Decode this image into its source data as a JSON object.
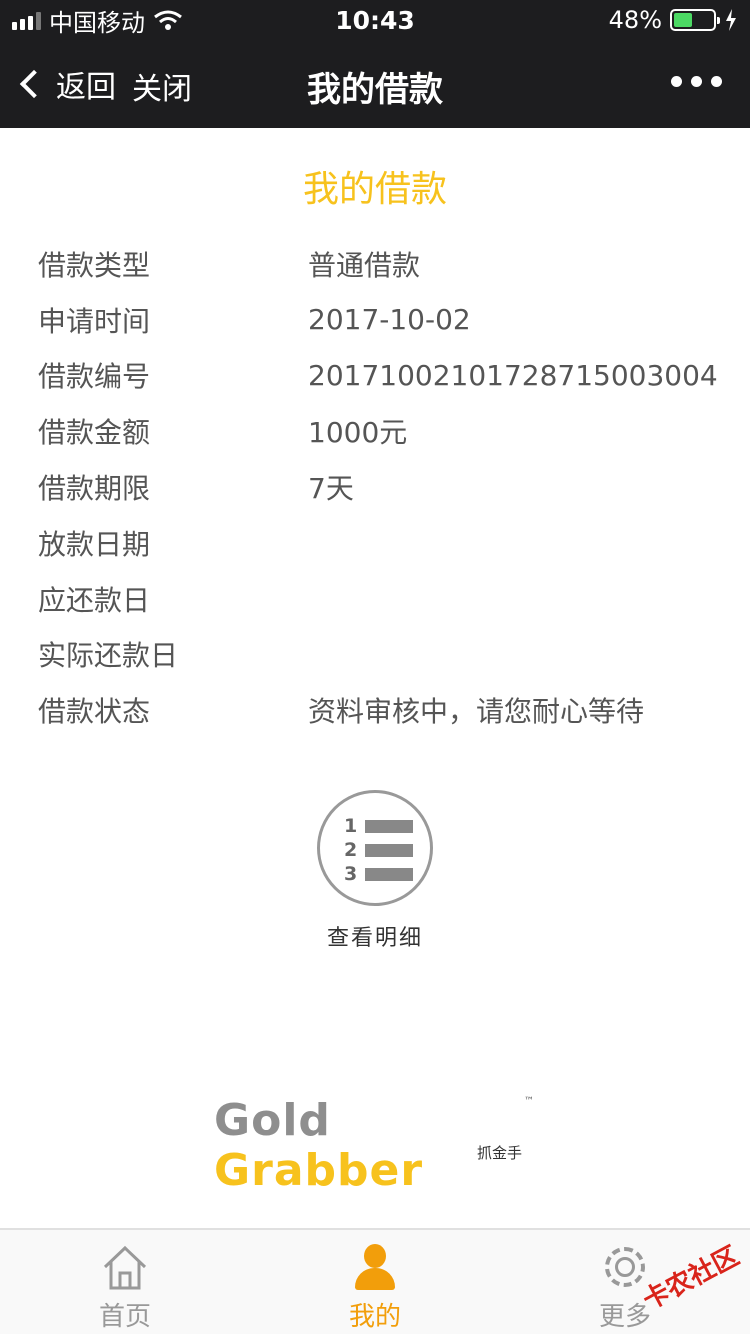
{
  "status_bar": {
    "carrier": "中国移动",
    "time": "10:43",
    "battery": "48%",
    "battery_level": 0.48
  },
  "nav": {
    "back_label": "返回",
    "close_label": "关闭",
    "title": "我的借款"
  },
  "page": {
    "heading": "我的借款"
  },
  "loan_info": [
    {
      "label": "借款类型",
      "value": "普通借款"
    },
    {
      "label": "申请时间",
      "value": "2017-10-02"
    },
    {
      "label": "借款编号",
      "value": "2017100210172871500300​4"
    },
    {
      "label": "借款金额",
      "value": "1000元"
    },
    {
      "label": "借款期限",
      "value": "7天"
    },
    {
      "label": "放款日期",
      "value": ""
    },
    {
      "label": "应还款日",
      "value": ""
    },
    {
      "label": "实际还款日",
      "value": ""
    },
    {
      "label": "借款状态",
      "value": "资料审核中，请您耐心等待"
    }
  ],
  "detail": {
    "label": "查看明细",
    "icon_numbers": [
      "1",
      "2",
      "3"
    ]
  },
  "logo": {
    "word1": "Gold",
    "word2": "Grabber",
    "tm": "™",
    "subtitle": "抓金手"
  },
  "tabs": [
    {
      "label": "首页",
      "icon": "home-icon"
    },
    {
      "label": "我的",
      "icon": "user-icon"
    },
    {
      "label": "更多",
      "icon": "gear-icon"
    }
  ],
  "watermark": "卡农社区",
  "colors": {
    "accent": "#f7c21d",
    "active_tab": "#f29e0b",
    "nav_bg": "#1d1d1f"
  }
}
